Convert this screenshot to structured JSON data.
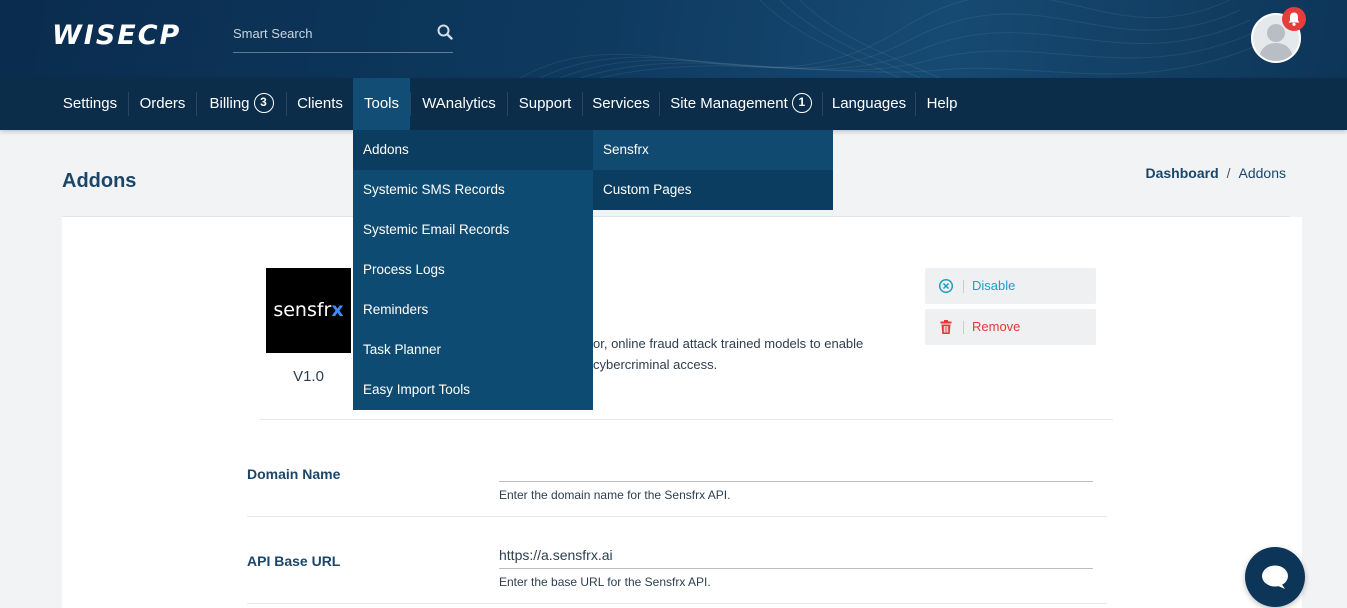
{
  "header": {
    "logo_text": "WISECP",
    "search_placeholder": "Smart Search",
    "icons": {
      "search": "search-icon",
      "notification": "bell-icon",
      "avatar": "user-avatar-icon"
    }
  },
  "nav": {
    "items": [
      {
        "label": "Settings"
      },
      {
        "label": "Orders"
      },
      {
        "label": "Billing",
        "badge": "3"
      },
      {
        "label": "Clients"
      },
      {
        "label": "Tools",
        "active": true
      },
      {
        "label": "WAnalytics"
      },
      {
        "label": "Support"
      },
      {
        "label": "Services"
      },
      {
        "label": "Site Management",
        "badge": "1"
      },
      {
        "label": "Languages"
      },
      {
        "label": "Help"
      }
    ]
  },
  "tools_menu": {
    "items": [
      {
        "label": "Addons",
        "highlighted": true
      },
      {
        "label": "Systemic SMS Records"
      },
      {
        "label": "Systemic Email Records"
      },
      {
        "label": "Process Logs"
      },
      {
        "label": "Reminders"
      },
      {
        "label": "Task Planner"
      },
      {
        "label": "Easy Import Tools"
      }
    ],
    "submenu": [
      {
        "label": "Sensfrx",
        "highlighted": true
      },
      {
        "label": "Custom Pages"
      }
    ]
  },
  "page": {
    "title": "Addons",
    "breadcrumb": {
      "home": "Dashboard",
      "separator": "/",
      "current": "Addons"
    }
  },
  "addon": {
    "logo_text": "sensfr",
    "logo_accent": "x",
    "version": "V1.0",
    "desc_line1": "or, online fraud attack trained models to enable",
    "desc_line2": "cybercriminal access.",
    "disable_label": "Disable",
    "remove_label": "Remove"
  },
  "form": {
    "domain": {
      "label": "Domain Name",
      "value": "",
      "help": "Enter the domain name for the Sensfrx API."
    },
    "api_url": {
      "label": "API Base URL",
      "value": "https://a.sensfrx.ai",
      "help": "Enter the base URL for the Sensfrx API."
    }
  },
  "colors": {
    "nav_bg": "#0b2d4a",
    "dropdown_bg": "#0e4b72",
    "accent_blue": "#1b4669",
    "disable": "#1f9fc4",
    "remove": "#e03a3a",
    "notification": "#e63c3c"
  }
}
